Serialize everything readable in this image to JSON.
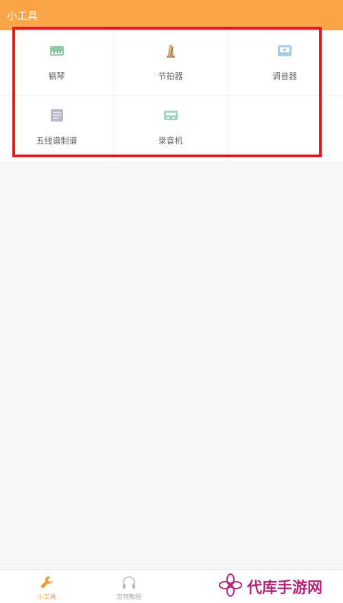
{
  "header": {
    "title": "小工具"
  },
  "tools": [
    {
      "label": "钢琴",
      "icon": "piano-icon"
    },
    {
      "label": "节拍器",
      "icon": "metronome-icon"
    },
    {
      "label": "调音器",
      "icon": "tuner-icon"
    },
    {
      "label": "五线谱制谱",
      "icon": "staff-notation-icon"
    },
    {
      "label": "录音机",
      "icon": "recorder-icon"
    }
  ],
  "tabbar": {
    "tabs": [
      {
        "label": "小工具",
        "icon": "wrench-icon",
        "active": true
      },
      {
        "label": "音频教程",
        "icon": "headphones-icon",
        "active": false
      }
    ]
  },
  "colors": {
    "header_bg": "#f9a54a",
    "active_tab": "#f39b3b",
    "highlight": "#e11b1b",
    "watermark": "#b4237a"
  },
  "watermark": {
    "text": "代库手游网",
    "icon": "flower-logo-icon"
  }
}
